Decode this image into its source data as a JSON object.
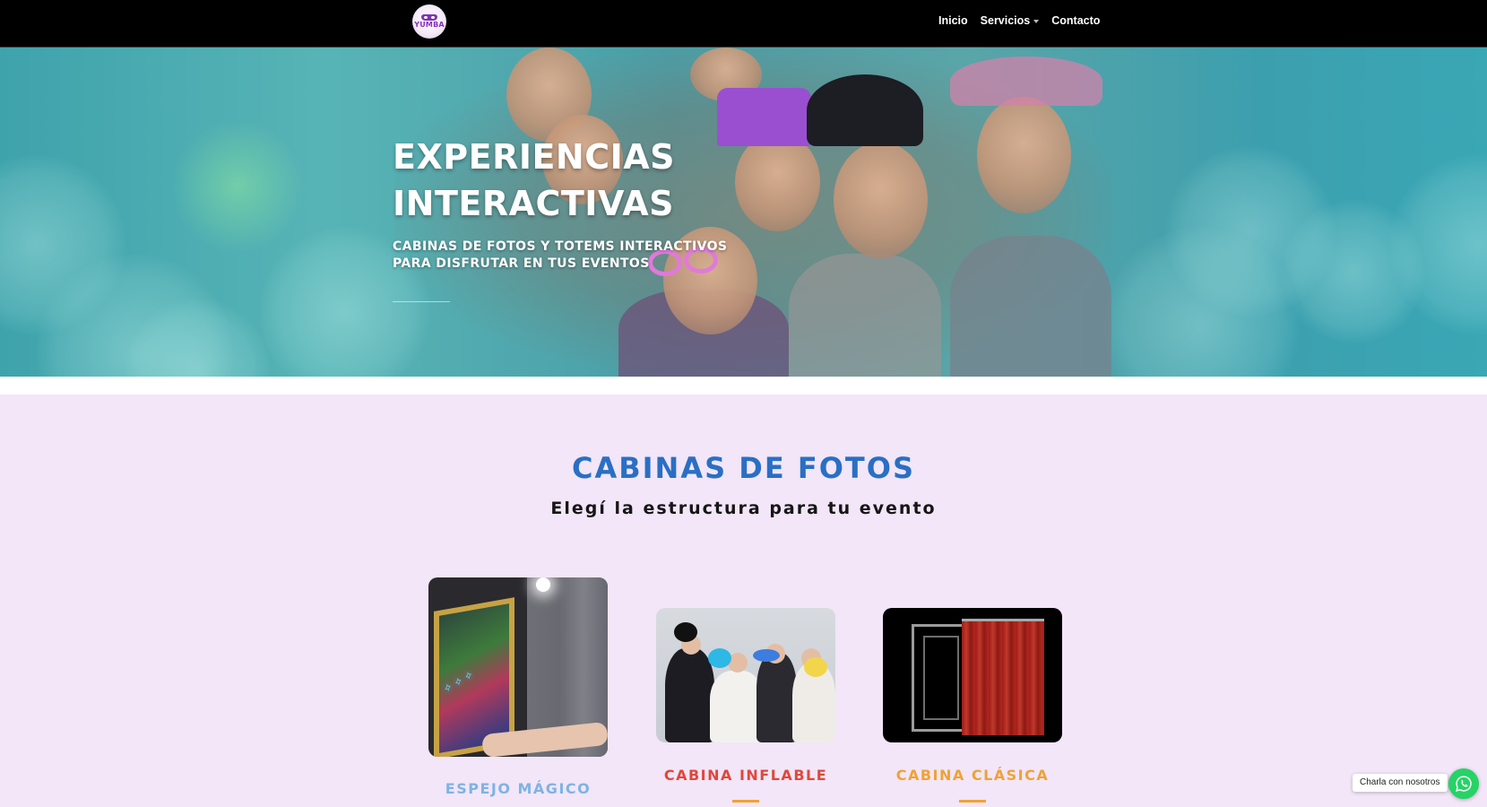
{
  "brand": {
    "logo_text": "YUMBA"
  },
  "nav": {
    "items": [
      {
        "label": "Inicio"
      },
      {
        "label": "Servicios"
      },
      {
        "label": "Contacto"
      }
    ]
  },
  "hero": {
    "title": "EXPERIENCIAS INTERACTIVAS",
    "subtitle": "CABINAS DE FOTOS Y TOTEMS INTERACTIVOS PARA DISFRUTAR EN TUS EVENTOS"
  },
  "section": {
    "title": "CABINAS DE FOTOS",
    "subtitle": "Elegí la estructura para tu evento"
  },
  "cards": [
    {
      "title": "ESPEJO MÁGICO",
      "title_color": "#7fb3e3"
    },
    {
      "title": "CABINA INFLABLE",
      "title_color": "#e3463a"
    },
    {
      "title": "CABINA CLÁSICA",
      "title_color": "#f0a234"
    }
  ],
  "whatsapp": {
    "label": "Charla con nosotros",
    "icon": "whatsapp-icon"
  },
  "colors": {
    "header_bg": "#000000",
    "section_bg": "#f2e6f8",
    "section_title": "#2a6fc4",
    "accent_orange": "#f0a234",
    "whatsapp_green": "#25d366"
  }
}
